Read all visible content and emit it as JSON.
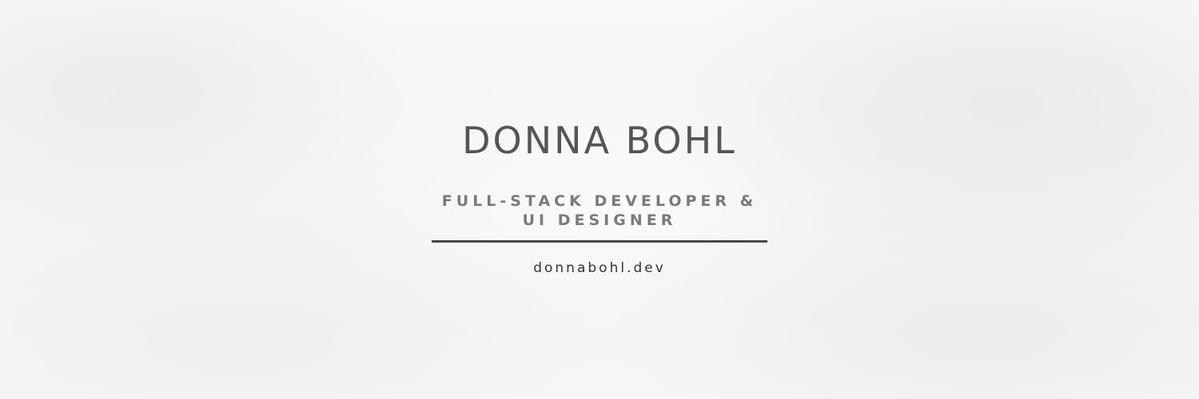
{
  "banner": {
    "name": "DONNA BOHL",
    "tagline_line1": "FULL-STACK DEVELOPER &",
    "tagline_line2": "UI DESIGNER",
    "website": "donnabohl.dev"
  },
  "colors": {
    "background": "#f6f6f6",
    "name_text": "#555555",
    "tagline_text": "#7a7a7a",
    "divider": "#4a4a4a",
    "website_text": "#333333"
  }
}
